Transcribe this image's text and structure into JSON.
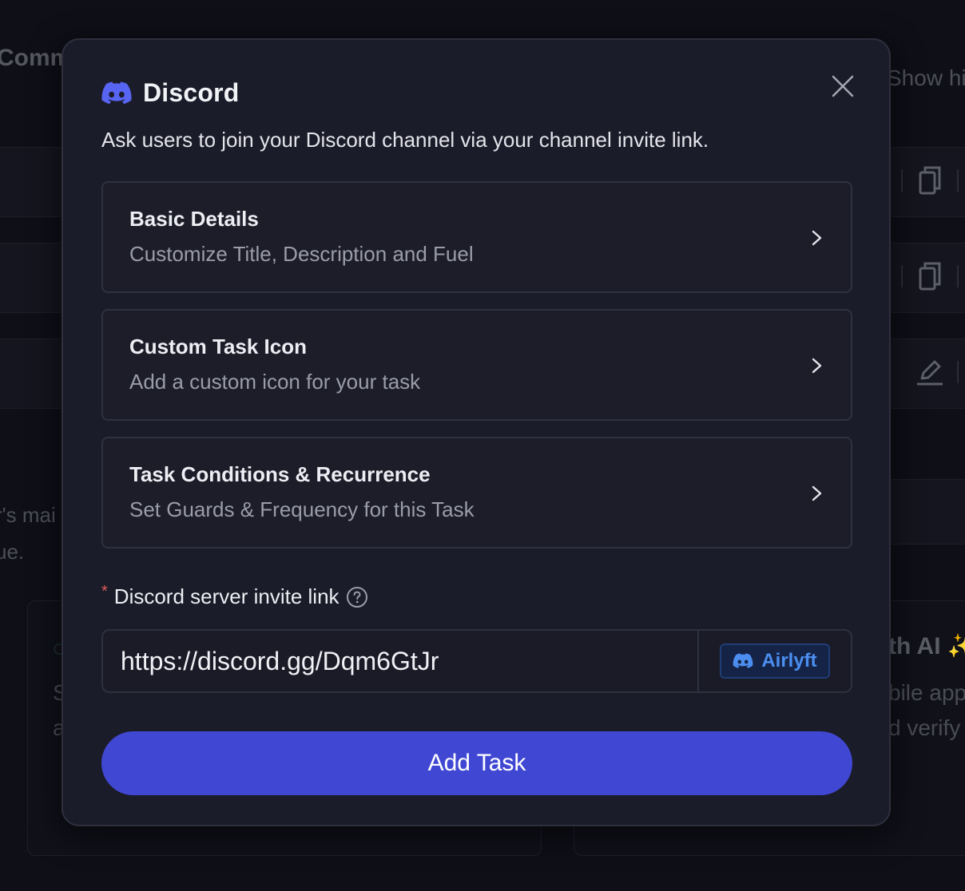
{
  "background": {
    "title_fragment": "Comm",
    "show_hidden_fragment": "Show hid",
    "desc_line1_fragment": "r's mai",
    "desc_line2_fragment": "ue.",
    "ai_fragment": "th AI ✨",
    "app_fragment": "bile app",
    "verify_fragment": "d verify",
    "card_line1_fragment": "S",
    "card_line2_fragment": "a"
  },
  "modal": {
    "icon": "discord-logo-icon",
    "title": "Discord",
    "subtitle": "Ask users to join your Discord channel via your channel invite link.",
    "sections": [
      {
        "title": "Basic Details",
        "subtitle": "Customize Title, Description and Fuel"
      },
      {
        "title": "Custom Task Icon",
        "subtitle": "Add a custom icon for your task"
      },
      {
        "title": "Task Conditions & Recurrence",
        "subtitle": "Set Guards & Frequency for this Task"
      }
    ],
    "invite_field": {
      "required_mark": "*",
      "label": "Discord server invite link",
      "value": "https://discord.gg/Dqm6GtJr",
      "badge_label": "Airlyft"
    },
    "submit_label": "Add Task"
  },
  "colors": {
    "accent": "#4048d3",
    "discord": "#5865f2",
    "badge_text": "#4b8ef0",
    "required": "#e05a5a"
  }
}
